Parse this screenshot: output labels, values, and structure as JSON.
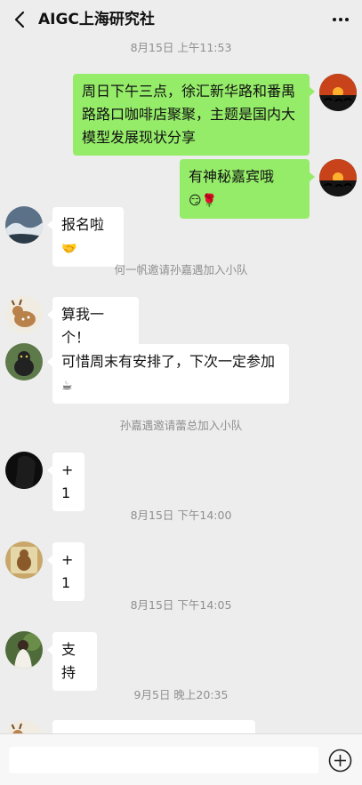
{
  "header": {
    "title": "AIGC上海研究社"
  },
  "messages": {
    "t1": "8月15日 上午11:53",
    "m1": "周日下午三点，徐汇新华路和番禺路路口咖啡店聚聚，主题是国内大模型发展现状分享",
    "m2": "有神秘嘉宾哦",
    "m2_emoji": "😏🌹",
    "m3": "报名啦",
    "m3_emoji": "🤝",
    "s1": "何一帆邀请孙嘉遇加入小队",
    "m4": "算我一个！",
    "m5": "可惜周末有安排了，下次一定参加",
    "m5_emoji": "☕",
    "s2": "孙嘉遇邀请蕾总加入小队",
    "m6": "+1",
    "t2": "8月15日 下午14:00",
    "m7": "+1",
    "t3": "8月15日 下午14:05",
    "m8": "支持",
    "t4": "9月5日 晚上20:35"
  },
  "input": {
    "placeholder": "",
    "value": ""
  },
  "colors": {
    "bg": "#ededed",
    "me_bubble": "#95ec69",
    "them_bubble": "#ffffff"
  }
}
